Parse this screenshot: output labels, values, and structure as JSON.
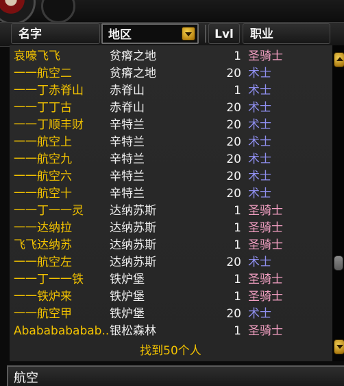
{
  "header": {
    "name_label": "名字",
    "zone_label": "地区",
    "level_label": "Lvl",
    "class_label": "职业"
  },
  "colors": {
    "paladin": "#f29fc2",
    "warlock": "#8f8ff0",
    "name": "#f2c200"
  },
  "rows": [
    {
      "name": "哀嚎飞飞",
      "zone": "贫瘠之地",
      "level": "1",
      "class": "圣骑士",
      "class_key": "paladin"
    },
    {
      "name": "一一航空二",
      "zone": "贫瘠之地",
      "level": "20",
      "class": "术士",
      "class_key": "warlock"
    },
    {
      "name": "一一丁赤脊山",
      "zone": "赤脊山",
      "level": "1",
      "class": "术士",
      "class_key": "warlock"
    },
    {
      "name": "一一丁丁古",
      "zone": "赤脊山",
      "level": "20",
      "class": "术士",
      "class_key": "warlock"
    },
    {
      "name": "一一丁顺丰财",
      "zone": "辛特兰",
      "level": "20",
      "class": "术士",
      "class_key": "warlock"
    },
    {
      "name": "一一航空上",
      "zone": "辛特兰",
      "level": "20",
      "class": "术士",
      "class_key": "warlock"
    },
    {
      "name": "一一航空九",
      "zone": "辛特兰",
      "level": "20",
      "class": "术士",
      "class_key": "warlock"
    },
    {
      "name": "一一航空六",
      "zone": "辛特兰",
      "level": "20",
      "class": "术士",
      "class_key": "warlock"
    },
    {
      "name": "一一航空十",
      "zone": "辛特兰",
      "level": "20",
      "class": "术士",
      "class_key": "warlock"
    },
    {
      "name": "一一丁一一灵",
      "zone": "达纳苏斯",
      "level": "1",
      "class": "圣骑士",
      "class_key": "paladin"
    },
    {
      "name": "一一达纳拉",
      "zone": "达纳苏斯",
      "level": "1",
      "class": "圣骑士",
      "class_key": "paladin"
    },
    {
      "name": "飞飞达纳苏",
      "zone": "达纳苏斯",
      "level": "1",
      "class": "圣骑士",
      "class_key": "paladin"
    },
    {
      "name": "一一航空左",
      "zone": "达纳苏斯",
      "level": "20",
      "class": "术士",
      "class_key": "warlock"
    },
    {
      "name": "一一丁一一铁",
      "zone": "铁炉堡",
      "level": "1",
      "class": "圣骑士",
      "class_key": "paladin"
    },
    {
      "name": "一一铁炉来",
      "zone": "铁炉堡",
      "level": "1",
      "class": "圣骑士",
      "class_key": "paladin"
    },
    {
      "name": "一一航空甲",
      "zone": "铁炉堡",
      "level": "20",
      "class": "术士",
      "class_key": "warlock"
    },
    {
      "name": "Abababababab...",
      "zone": "银松森林",
      "level": "1",
      "class": "圣骑士",
      "class_key": "paladin"
    }
  ],
  "footer": "找到50个人",
  "search": {
    "value": "航空"
  }
}
